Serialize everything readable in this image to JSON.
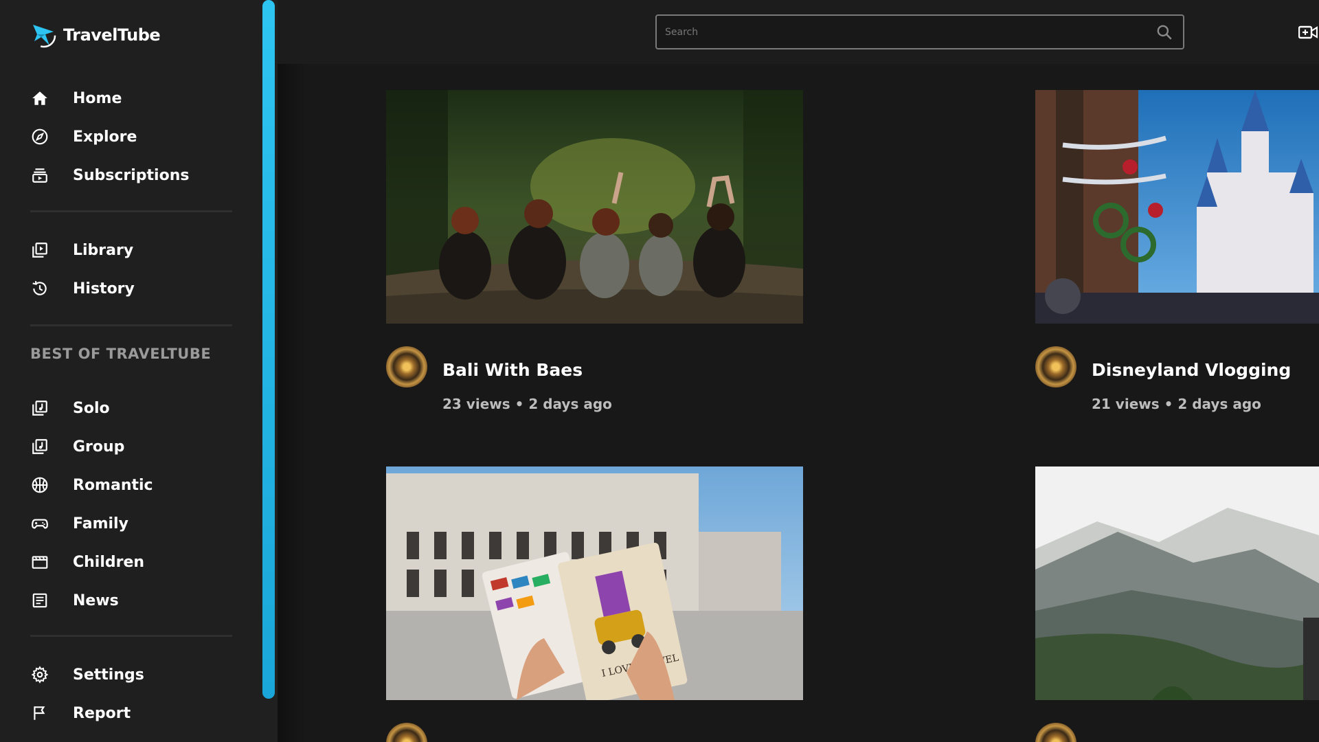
{
  "app": {
    "name": "TravelTube"
  },
  "search": {
    "placeholder": "Search"
  },
  "sidebar": {
    "primary": [
      {
        "label": "Home",
        "icon": "home-icon"
      },
      {
        "label": "Explore",
        "icon": "compass-icon"
      },
      {
        "label": "Subscriptions",
        "icon": "subscriptions-icon"
      }
    ],
    "secondary": [
      {
        "label": "Library",
        "icon": "library-icon"
      },
      {
        "label": "History",
        "icon": "history-icon"
      }
    ],
    "section_title": "BEST OF TRAVELTUBE",
    "categories": [
      {
        "label": "Solo",
        "icon": "music-library-icon"
      },
      {
        "label": "Group",
        "icon": "music-library-icon"
      },
      {
        "label": "Romantic",
        "icon": "basketball-icon"
      },
      {
        "label": "Family",
        "icon": "gamepad-icon"
      },
      {
        "label": "Children",
        "icon": "movie-icon"
      },
      {
        "label": "News",
        "icon": "news-icon"
      }
    ],
    "footer": [
      {
        "label": "Settings",
        "icon": "gear-icon"
      },
      {
        "label": "Report",
        "icon": "flag-icon"
      }
    ]
  },
  "videos": [
    {
      "title": "Bali With Baes",
      "meta": "23 views • 2 days ago"
    },
    {
      "title": "Disneyland Vlogging",
      "meta": "21 views • 2 days ago"
    }
  ],
  "colors": {
    "accent": "#2ec4f1",
    "background": "#181818",
    "sidebar": "#1f1f1f"
  }
}
